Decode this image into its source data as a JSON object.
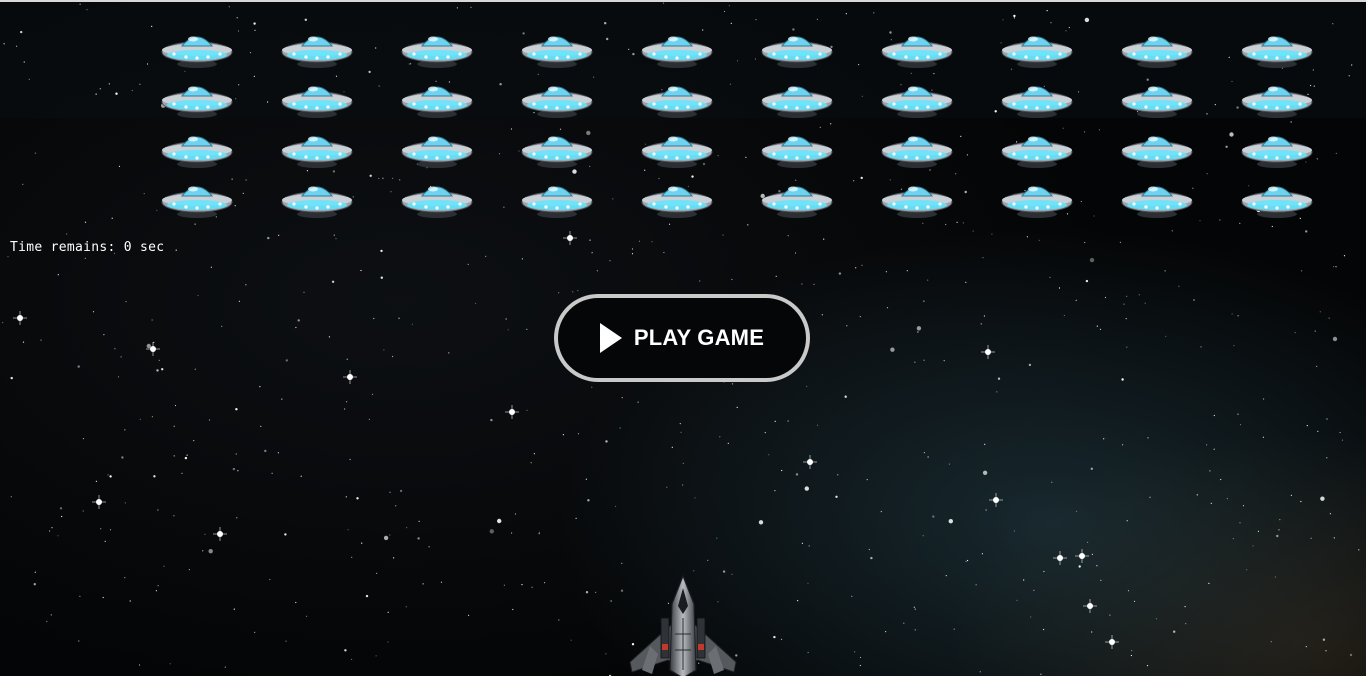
{
  "game": {
    "timer_text": "Time remains: 0 sec",
    "play_button_label": "PLAY GAME",
    "alien_rows": 4,
    "alien_cols": 10
  },
  "colors": {
    "background": "#040506",
    "ufo_dome": "#6fd3f0",
    "ufo_lights": "#5ee6ff",
    "button_border": "#c9c9c9",
    "text": "#ffffff"
  },
  "icons": {
    "alien": "ufo-icon",
    "player": "spaceship-icon",
    "play": "play-triangle-icon"
  }
}
